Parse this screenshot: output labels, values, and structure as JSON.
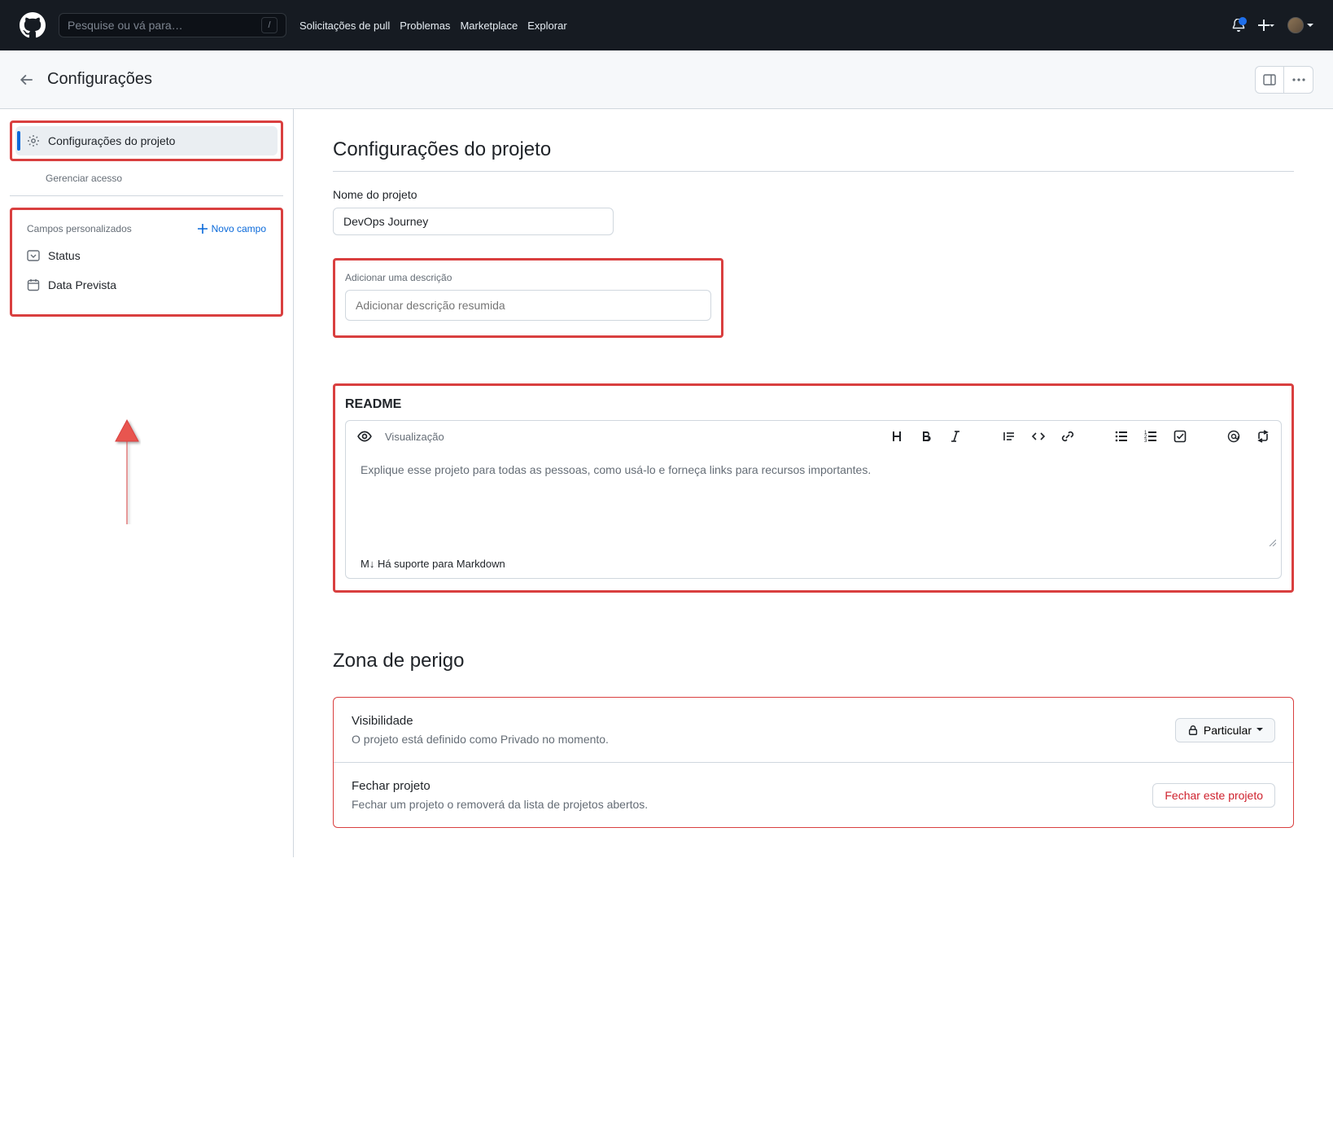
{
  "topnav": {
    "search_placeholder": "Pesquise ou vá para…",
    "links": [
      "Solicitações de pull",
      "Problemas",
      "Marketplace",
      "Explorar"
    ]
  },
  "subheader": {
    "title": "Configurações"
  },
  "sidebar": {
    "project_settings": "Configurações do projeto",
    "manage_access": "Gerenciar acesso",
    "custom_fields_header": "Campos personalizados",
    "new_field": "Novo campo",
    "field_status": "Status",
    "field_date": "Data Prevista"
  },
  "project": {
    "heading": "Configurações do projeto",
    "name_label": "Nome do projeto",
    "name_value": "DevOps Journey",
    "desc_label": "Adicionar uma descrição",
    "desc_placeholder": "Adicionar descrição resumida"
  },
  "readme": {
    "heading": "README",
    "preview": "Visualização",
    "placeholder": "Explique esse projeto para todas as pessoas, como usá-lo e forneça links para recursos importantes.",
    "footer": "M↓ Há suporte para Markdown"
  },
  "danger": {
    "heading": "Zona de perigo",
    "visibility_title": "Visibilidade",
    "visibility_sub": "O projeto está definido como Privado no momento.",
    "visibility_btn": "Particular",
    "close_title": "Fechar projeto",
    "close_sub": "Fechar um projeto o removerá da lista de projetos abertos.",
    "close_btn": "Fechar este projeto"
  }
}
